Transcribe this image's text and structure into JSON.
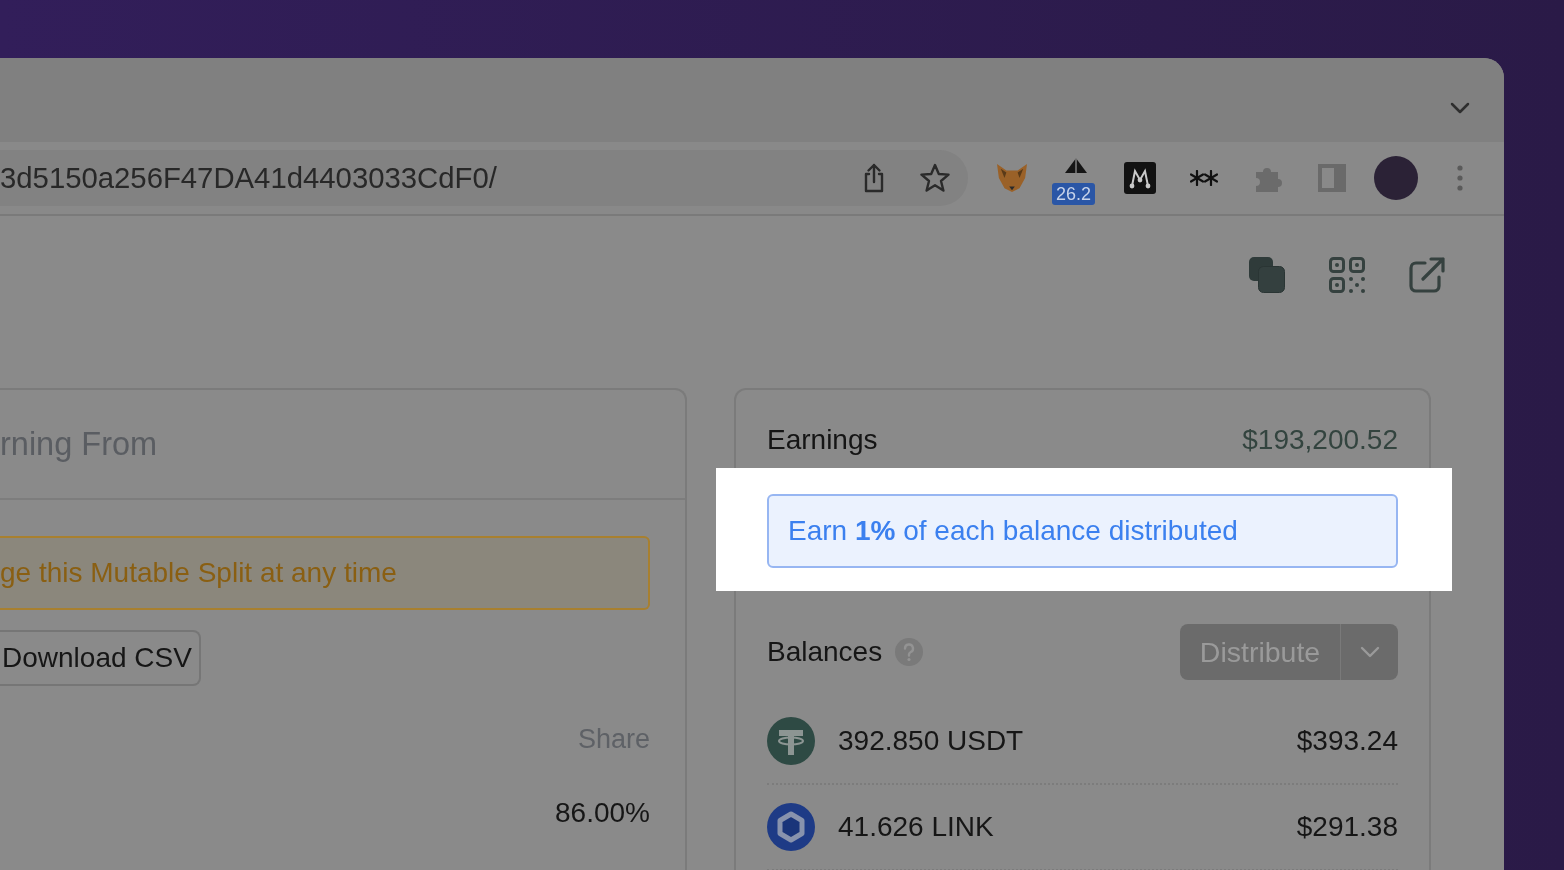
{
  "browser": {
    "address_bar": {
      "url": "3d5150a256F47DA41d4403033CdF0/"
    },
    "extension_badge": "26.2"
  },
  "page": {
    "left_card": {
      "title": "rning From",
      "notice": "ge this Mutable Split at any time",
      "download_button": "Download CSV",
      "columns": [
        "Share"
      ],
      "rows": [
        {
          "share": "86.00%"
        }
      ]
    },
    "right_card": {
      "title": "Earnings",
      "total": "$193,200.52",
      "promo": {
        "text": "Earn **1%** of each balance distributed",
        "highlighted": true
      },
      "balances_title": "Balances",
      "distribute_button": {
        "label": "Distribute",
        "disabled": true
      },
      "balances": [
        {
          "kind": "tee",
          "amount": "392.850 USDT",
          "value": "$393.24"
        },
        {
          "kind": "hexagon",
          "amount": "41.626 LINK",
          "value": "$291.38"
        }
      ]
    }
  }
}
